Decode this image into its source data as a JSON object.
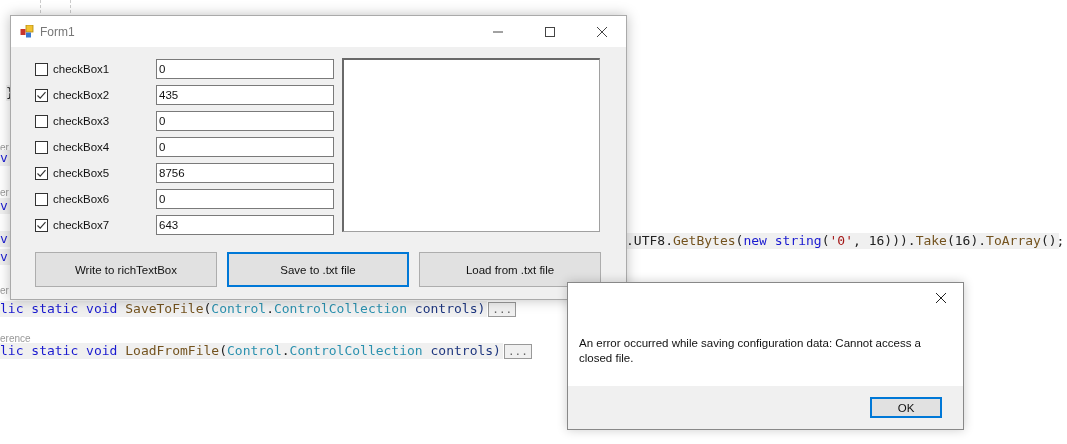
{
  "editor": {
    "fragments": [
      {
        "kind": "code",
        "tokens": [
          {
            "text": "}",
            "kind": "plain"
          }
        ]
      },
      {
        "kind": "reference",
        "text": "er"
      },
      {
        "kind": "code",
        "tokens": [
          {
            "text": "v",
            "kind": "keyword"
          }
        ]
      },
      {
        "kind": "reference",
        "text": "er"
      },
      {
        "kind": "code",
        "tokens": [
          {
            "text": "v",
            "kind": "keyword"
          }
        ]
      },
      {
        "kind": "code",
        "tokens": [
          {
            "text": "v",
            "kind": "keyword"
          }
        ]
      },
      {
        "kind": "code",
        "tokens": [
          {
            "text": ".UTF8.",
            "kind": "plain"
          },
          {
            "text": "GetBytes",
            "kind": "method"
          },
          {
            "text": "(",
            "kind": "plain"
          },
          {
            "text": "new string",
            "kind": "keyword"
          },
          {
            "text": "(",
            "kind": "plain"
          },
          {
            "text": "'0'",
            "kind": "string"
          },
          {
            "text": ", 16))).",
            "kind": "plain"
          },
          {
            "text": "Take",
            "kind": "method"
          },
          {
            "text": "(16).",
            "kind": "plain"
          },
          {
            "text": "ToArray",
            "kind": "method"
          },
          {
            "text": "();",
            "kind": "plain"
          }
        ]
      },
      {
        "kind": "code",
        "tokens": [
          {
            "text": "v",
            "kind": "keyword"
          }
        ]
      },
      {
        "kind": "reference",
        "text": "er"
      },
      {
        "kind": "code",
        "tokens": [
          {
            "text": "lic static void ",
            "kind": "keyword"
          },
          {
            "text": "SaveToFile",
            "kind": "method"
          },
          {
            "text": "(",
            "kind": "plain"
          },
          {
            "text": "Control",
            "kind": "type"
          },
          {
            "text": ".",
            "kind": "plain"
          },
          {
            "text": "ControlCollection",
            "kind": "type"
          },
          {
            "text": " controls)",
            "kind": "param"
          },
          {
            "text": "...",
            "kind": "fold"
          }
        ]
      },
      {
        "kind": "reference",
        "text": "erence"
      },
      {
        "kind": "code",
        "tokens": [
          {
            "text": "lic static void ",
            "kind": "keyword"
          },
          {
            "text": "LoadFromFile",
            "kind": "method"
          },
          {
            "text": "(",
            "kind": "plain"
          },
          {
            "text": "Control",
            "kind": "type"
          },
          {
            "text": ".",
            "kind": "plain"
          },
          {
            "text": "ControlCollection",
            "kind": "type"
          },
          {
            "text": " controls)",
            "kind": "param"
          },
          {
            "text": "...",
            "kind": "fold"
          }
        ]
      }
    ]
  },
  "form": {
    "title": "Form1",
    "rows": [
      {
        "label": "checkBox1",
        "checked": false,
        "value": "0"
      },
      {
        "label": "checkBox2",
        "checked": true,
        "value": "435"
      },
      {
        "label": "checkBox3",
        "checked": false,
        "value": "0"
      },
      {
        "label": "checkBox4",
        "checked": false,
        "value": "0"
      },
      {
        "label": "checkBox5",
        "checked": true,
        "value": "8756"
      },
      {
        "label": "checkBox6",
        "checked": false,
        "value": "0"
      },
      {
        "label": "checkBox7",
        "checked": true,
        "value": "643"
      }
    ],
    "buttons": [
      {
        "label": "Write to richTextBox",
        "focused": false
      },
      {
        "label": "Save to .txt file",
        "focused": true
      },
      {
        "label": "Load from .txt file",
        "focused": false
      }
    ]
  },
  "dialog": {
    "message": "An error occurred while saving configuration data: Cannot access a closed file.",
    "button": {
      "label": "OK",
      "focused": true
    }
  }
}
